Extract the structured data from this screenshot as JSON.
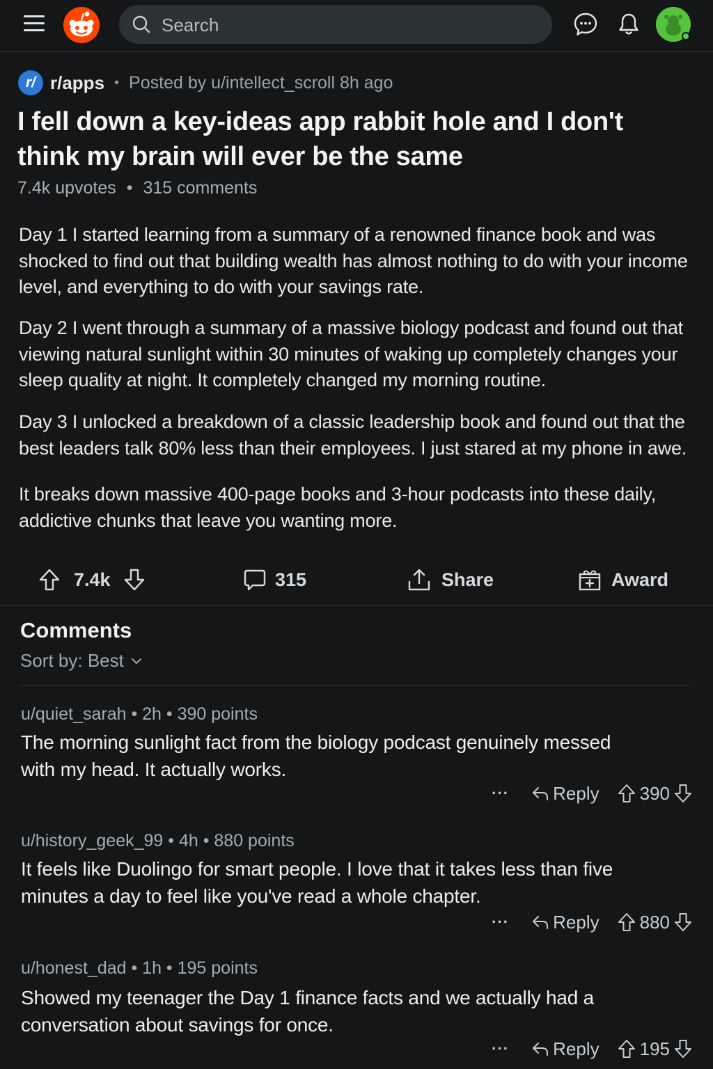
{
  "colors": {
    "background": "#141618",
    "accent_reddit": "#ff4500",
    "subreddit_icon": "#2e79d6",
    "avatar": "#55c33c"
  },
  "header": {
    "search_placeholder": "Search",
    "icons": [
      "menu-icon",
      "reddit-logo-icon",
      "search-icon",
      "chat-icon",
      "bell-icon",
      "user-avatar"
    ]
  },
  "post": {
    "subreddit_icon_text": "r/",
    "subreddit": "r/apps",
    "posted_by": "Posted by u/intellect_scroll 8h ago",
    "title": "I fell down a key-ideas app rabbit hole and I don't think my brain will ever be the same",
    "upvotes_text": "7.4k upvotes",
    "comments_text": "315 comments",
    "paragraphs": [
      "Day 1 I started learning from a summary of a renowned finance book and was shocked to find out that building wealth has almost nothing to do with your income level, and everything to do with your savings rate.",
      "Day 2 I went through a summary of a massive biology podcast and found out that viewing natural sunlight within 30 minutes of waking up completely changes your sleep quality at night. It completely changed my morning routine.",
      "Day 3 I unlocked a breakdown of a classic leadership book and found out that the best leaders talk 80% less than their employees. I just stared at my phone in awe.",
      "It breaks down massive 400-page books and 3-hour podcasts into these daily, addictive chunks that leave you wanting more."
    ],
    "actions": {
      "score": "7.4k",
      "comments": "315",
      "share": "Share",
      "award": "Award"
    }
  },
  "comments_section": {
    "title": "Comments",
    "sort_label": "Sort by: Best",
    "reply_label": "Reply",
    "more_label": "···",
    "comments": [
      {
        "meta": "u/quiet_sarah • 2h • 390 points",
        "body": "The morning sunlight fact from the biology podcast genuinely messed with my head. It actually works.",
        "score": "390"
      },
      {
        "meta": "u/history_geek_99 • 4h • 880 points",
        "body": "It feels like Duolingo for smart people. I love that it takes less than five minutes a day to feel like you've read a whole chapter.",
        "score": "880"
      },
      {
        "meta": "u/honest_dad • 1h • 195 points",
        "body": "Showed my teenager the Day 1 finance facts and we actually had a conversation about savings for once.",
        "score": "195"
      }
    ]
  }
}
